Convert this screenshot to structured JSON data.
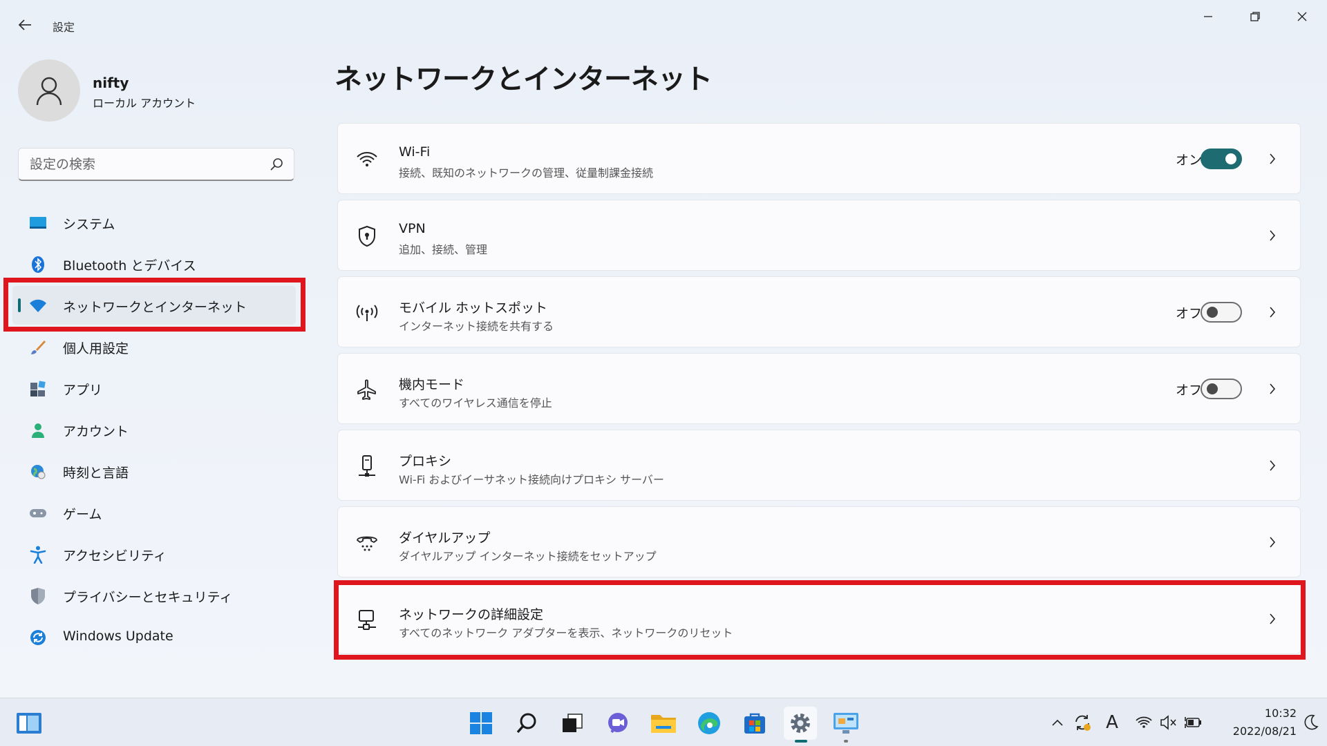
{
  "window": {
    "app_title": "設定"
  },
  "profile": {
    "name": "nifty",
    "account_type": "ローカル アカウント"
  },
  "search": {
    "placeholder": "設定の検索"
  },
  "sidebar": {
    "items": [
      {
        "label": "システム",
        "icon": "system-icon"
      },
      {
        "label": "Bluetooth とデバイス",
        "icon": "bluetooth-icon"
      },
      {
        "label": "ネットワークとインターネット",
        "icon": "wifi-icon",
        "active": true
      },
      {
        "label": "個人用設定",
        "icon": "brush-icon"
      },
      {
        "label": "アプリ",
        "icon": "apps-icon"
      },
      {
        "label": "アカウント",
        "icon": "account-icon"
      },
      {
        "label": "時刻と言語",
        "icon": "globe-clock-icon"
      },
      {
        "label": "ゲーム",
        "icon": "gamepad-icon"
      },
      {
        "label": "アクセシビリティ",
        "icon": "accessibility-icon"
      },
      {
        "label": "プライバシーとセキュリティ",
        "icon": "shield-icon"
      },
      {
        "label": "Windows Update",
        "icon": "update-icon"
      }
    ]
  },
  "main": {
    "title": "ネットワークとインターネット",
    "cards": [
      {
        "title": "Wi-Fi",
        "subtitle": "接続、既知のネットワークの管理、従量制課金接続",
        "toggle": "オン",
        "toggle_on": true
      },
      {
        "title": "VPN",
        "subtitle": "追加、接続、管理"
      },
      {
        "title": "モバイル ホットスポット",
        "subtitle": "インターネット接続を共有する",
        "toggle": "オフ",
        "toggle_on": false
      },
      {
        "title": "機内モード",
        "subtitle": "すべてのワイヤレス通信を停止",
        "toggle": "オフ",
        "toggle_on": false
      },
      {
        "title": "プロキシ",
        "subtitle": "Wi-Fi およびイーサネット接続向けプロキシ サーバー"
      },
      {
        "title": "ダイヤルアップ",
        "subtitle": "ダイヤルアップ インターネット接続をセットアップ"
      },
      {
        "title": "ネットワークの詳細設定",
        "subtitle": "すべてのネットワーク アダプターを表示、ネットワークのリセット"
      }
    ]
  },
  "taskbar": {
    "time": "10:32",
    "date": "2022/08/21",
    "ime": "A"
  },
  "colors": {
    "accent": "#0f6c73",
    "highlight": "#e0161e"
  }
}
